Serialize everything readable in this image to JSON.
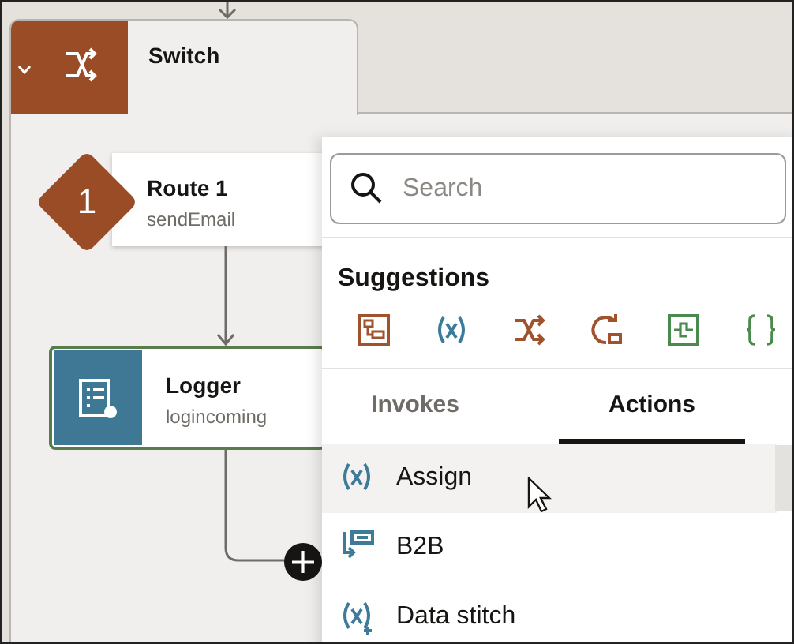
{
  "switch_node": {
    "title": "Switch",
    "expanded": true
  },
  "route_node": {
    "number": "1",
    "title": "Route 1",
    "subtitle": "sendEmail"
  },
  "logger_node": {
    "title": "Logger",
    "subtitle": "logincoming",
    "selected": true
  },
  "panel": {
    "search": {
      "placeholder": "Search"
    },
    "suggestions_title": "Suggestions",
    "suggestions": [
      {
        "kind": "map"
      },
      {
        "kind": "variable"
      },
      {
        "kind": "switch"
      },
      {
        "kind": "loop"
      },
      {
        "kind": "integration"
      },
      {
        "kind": "json"
      }
    ],
    "tabs": [
      {
        "label": "Invokes",
        "selected": false
      },
      {
        "label": "Actions",
        "selected": true
      }
    ],
    "items": [
      {
        "kind": "variable",
        "label": "Assign",
        "selected": true
      },
      {
        "kind": "b2b",
        "label": "B2B",
        "selected": false
      },
      {
        "kind": "stitch",
        "label": "Data stitch",
        "selected": false
      }
    ]
  }
}
